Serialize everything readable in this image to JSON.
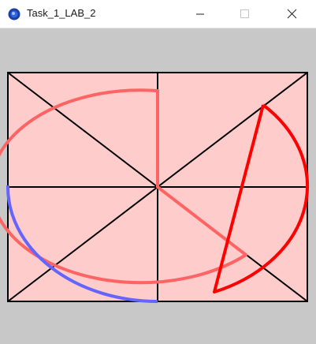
{
  "window": {
    "title": "Task_1_LAB_2",
    "controls": [
      "minimize",
      "maximize",
      "close"
    ],
    "icon": "processing-app-icon"
  },
  "sketch": {
    "background_color": "#c8c8c8",
    "rect_fill": "#ffcccc",
    "stroke_black": "#000000",
    "pie_color": "#ff6464",
    "blue_arc_color": "#6464ff",
    "triangle_color": "#ff0000"
  }
}
